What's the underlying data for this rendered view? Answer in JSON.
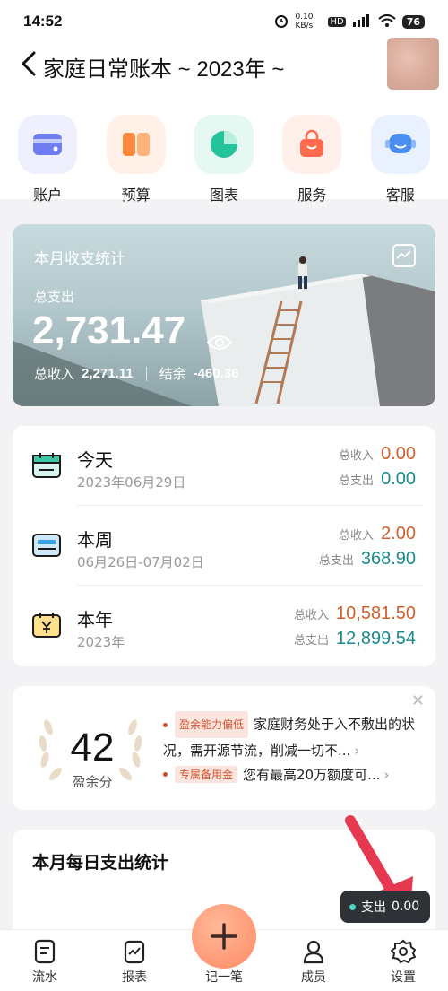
{
  "status_bar": {
    "time": "14:52",
    "net_speed": "0.10 KB/s",
    "battery": "76"
  },
  "header": {
    "title": "家庭日常账本 ~ 2023年 ~"
  },
  "quick_menu": [
    {
      "label": "账户",
      "icon": "wallet-icon",
      "color": "#6f7cf2"
    },
    {
      "label": "预算",
      "icon": "budget-icon",
      "color": "#ff8a3d"
    },
    {
      "label": "图表",
      "icon": "pie-chart-icon",
      "color": "#24c39b"
    },
    {
      "label": "服务",
      "icon": "shopping-bag-icon",
      "color": "#ff6a4d"
    },
    {
      "label": "客服",
      "icon": "customer-service-icon",
      "color": "#4a8ff0"
    }
  ],
  "monthly_stats": {
    "title": "本月收支统计",
    "total_expense_label": "总支出",
    "total_expense": "2,731.47",
    "income_label": "总收入",
    "income": "2,271.11",
    "balance_label": "结余",
    "balance": "-460.36"
  },
  "periods": [
    {
      "name": "今天",
      "date": "2023年06月29日",
      "income_label": "总收入",
      "income": "0.00",
      "expense_label": "总支出",
      "expense": "0.00",
      "icon": "calendar-today-icon"
    },
    {
      "name": "本周",
      "date": "06月26日-07月02日",
      "income_label": "总收入",
      "income": "2.00",
      "expense_label": "总支出",
      "expense": "368.90",
      "icon": "card-week-icon"
    },
    {
      "name": "本年",
      "date": "2023年",
      "income_label": "总收入",
      "income": "10,581.50",
      "expense_label": "总支出",
      "expense": "12,899.54",
      "icon": "yuan-calendar-icon"
    }
  ],
  "surplus": {
    "score": "42",
    "score_label": "盈余分",
    "tip1_tag": "盈余能力偏低",
    "tip1_text": "家庭财务处于入不敷出的状况，需开源节流，削减一切不...",
    "tip2_tag": "专属备用金",
    "tip2_text": "您有最高20万额度可..."
  },
  "daily": {
    "title": "本月每日支出统计"
  },
  "floating_pill": {
    "label": "支出",
    "value": "0.00"
  },
  "tabbar": {
    "items": [
      {
        "label": "流水",
        "icon": "list-icon"
      },
      {
        "label": "报表",
        "icon": "report-icon"
      },
      {
        "label": "记一笔",
        "icon": "plus-icon"
      },
      {
        "label": "成员",
        "icon": "member-icon"
      },
      {
        "label": "设置",
        "icon": "settings-gear-icon"
      }
    ]
  }
}
